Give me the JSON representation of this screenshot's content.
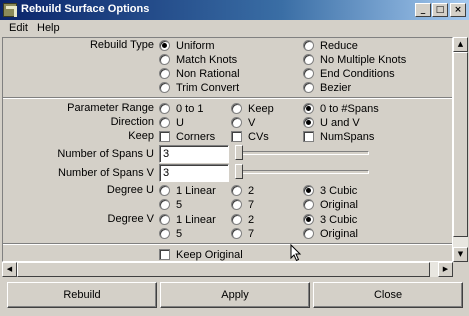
{
  "window": {
    "title": "Rebuild Surface Options"
  },
  "window_buttons": {
    "minimize": "_",
    "maximize": "□",
    "close": "×"
  },
  "menu": {
    "edit": "Edit",
    "help": "Help"
  },
  "rebuild_type": {
    "label": "Rebuild Type",
    "options": [
      "Uniform",
      "Reduce",
      "Match Knots",
      "No Multiple Knots",
      "Non Rational",
      "End Conditions",
      "Trim Convert",
      "Bezier"
    ],
    "selected": "Uniform"
  },
  "parameter_range": {
    "label": "Parameter Range",
    "options": [
      "0 to 1",
      "Keep",
      "0 to #Spans"
    ],
    "selected": "0 to #Spans"
  },
  "direction": {
    "label": "Direction",
    "options": [
      "U",
      "V",
      "U and V"
    ],
    "selected": "U and V"
  },
  "keep": {
    "label": "Keep",
    "options": [
      "Corners",
      "CVs",
      "NumSpans"
    ],
    "checked": []
  },
  "spans_u": {
    "label": "Number of Spans U",
    "value": "3"
  },
  "spans_v": {
    "label": "Number of Spans V",
    "value": "3"
  },
  "degree_u": {
    "label": "Degree U",
    "options": [
      "1 Linear",
      "2",
      "3 Cubic",
      "5",
      "7",
      "Original"
    ],
    "selected": "3 Cubic"
  },
  "degree_v": {
    "label": "Degree V",
    "options": [
      "1 Linear",
      "2",
      "3 Cubic",
      "5",
      "7",
      "Original"
    ],
    "selected": "3 Cubic"
  },
  "keep_original": {
    "label": "Keep Original",
    "checked": false
  },
  "scroll_arrows": {
    "up": "▲",
    "down": "▼",
    "left": "◀",
    "right": "▶"
  },
  "buttons": {
    "rebuild": "Rebuild",
    "apply": "Apply",
    "close": "Close"
  }
}
